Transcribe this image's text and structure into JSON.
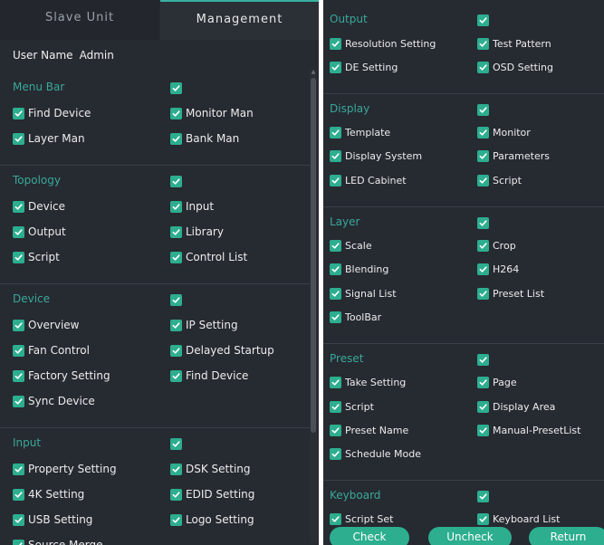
{
  "tabs": {
    "inactive": "Slave Unit",
    "active": "Management"
  },
  "user": {
    "label": "User Name",
    "value": "Admin"
  },
  "left_sections": [
    {
      "title": "Menu Bar",
      "items": [
        "Find Device",
        "Monitor Man",
        "Layer Man",
        "Bank Man"
      ]
    },
    {
      "title": "Topology",
      "items": [
        "Device",
        "Input",
        "Output",
        "Library",
        "Script",
        "Control List"
      ]
    },
    {
      "title": "Device",
      "items": [
        "Overview",
        "IP Setting",
        "Fan Control",
        "Delayed Startup",
        "Factory Setting",
        "Find Device",
        "Sync Device"
      ]
    },
    {
      "title": "Input",
      "items": [
        "Property Setting",
        "DSK Setting",
        "4K Setting",
        "EDID Setting",
        "USB Setting",
        "Logo Setting",
        "Source Merge"
      ]
    }
  ],
  "right_sections": [
    {
      "title": "Output",
      "items": [
        "Resolution Setting",
        "Test Pattern",
        "DE Setting",
        "OSD Setting"
      ]
    },
    {
      "title": "Display",
      "items": [
        "Template",
        "Monitor",
        "Display System",
        "Parameters",
        "LED Cabinet",
        "Script"
      ]
    },
    {
      "title": "Layer",
      "items": [
        "Scale",
        "Crop",
        "Blending",
        "H264",
        "Signal List",
        "Preset List",
        "ToolBar"
      ]
    },
    {
      "title": "Preset",
      "items": [
        "Take Setting",
        "Page",
        "Script",
        "Display Area",
        "Preset Name",
        "Manual-PresetList",
        "Schedule Mode"
      ]
    },
    {
      "title": "Keyboard",
      "items": [
        "Script Set",
        "Keyboard List"
      ]
    }
  ],
  "buttons": {
    "check": "Check",
    "uncheck": "Uncheck",
    "return": "Return"
  },
  "colors": {
    "accent": "#2cae8f",
    "section_title": "#3aa89a",
    "panel_bg": "#262a31"
  }
}
